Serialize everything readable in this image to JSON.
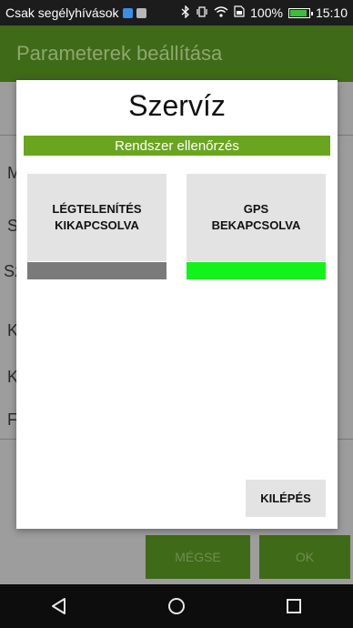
{
  "status_bar": {
    "carrier_text": "Csak segélyhívások",
    "battery_percent": "100%",
    "time": "15:10",
    "icons": [
      "notification-square-icon",
      "image-icon",
      "bluetooth-icon",
      "vibrate-icon",
      "wifi-icon",
      "sim-icon",
      "battery-icon"
    ],
    "battery_level": 0.8
  },
  "app": {
    "title": "Parameterek beállítása",
    "rows": [
      "M",
      "S",
      "Sz",
      "K",
      "K",
      "F"
    ],
    "buttons": {
      "left_label": "MÉGSE",
      "right_label": "OK"
    }
  },
  "dialog": {
    "title": "Szervíz",
    "section_label": "Rendszer ellenőrzés",
    "tiles": [
      {
        "label": "LÉGTELENÍTÉS\nKIKAPCSOLVA",
        "status_color": "#7a7a7a"
      },
      {
        "label": "GPS\nBEKAPCSOLVA",
        "status_color": "#12f31a"
      }
    ],
    "exit_label": "KILÉPÉS"
  },
  "nav": {
    "icons": [
      "back-icon",
      "home-icon",
      "recents-icon"
    ]
  },
  "colors": {
    "accent_green": "#6aa51f",
    "status_on": "#12f31a",
    "status_off": "#7a7a7a",
    "app_bar": "#3f6a18"
  }
}
